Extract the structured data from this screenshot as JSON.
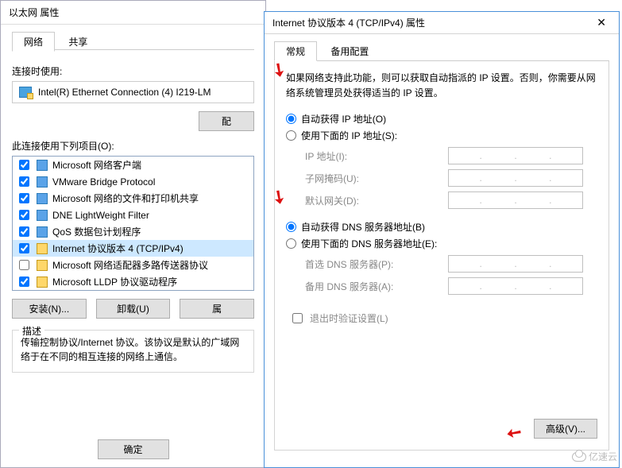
{
  "back": {
    "title": "以太网 属性",
    "tabs": {
      "network": "网络",
      "share": "共享"
    },
    "connect_using": "连接时使用:",
    "adapter": "Intel(R) Ethernet Connection (4) I219-LM",
    "configure_btn": "配",
    "items_label": "此连接使用下列项目(O):",
    "items": [
      {
        "checked": true,
        "icon": "blue",
        "label": "Microsoft 网络客户端"
      },
      {
        "checked": true,
        "icon": "blue",
        "label": "VMware Bridge Protocol"
      },
      {
        "checked": true,
        "icon": "blue",
        "label": "Microsoft 网络的文件和打印机共享"
      },
      {
        "checked": true,
        "icon": "blue",
        "label": "DNE LightWeight Filter"
      },
      {
        "checked": true,
        "icon": "blue",
        "label": "QoS 数据包计划程序"
      },
      {
        "checked": true,
        "icon": "yellow",
        "label": "Internet 协议版本 4 (TCP/IPv4)",
        "selected": true
      },
      {
        "checked": false,
        "icon": "yellow",
        "label": "Microsoft 网络适配器多路传送器协议"
      },
      {
        "checked": true,
        "icon": "yellow",
        "label": "Microsoft LLDP 协议驱动程序"
      }
    ],
    "install_btn": "安装(N)...",
    "uninstall_btn": "卸载(U)",
    "props_btn": "属",
    "desc_legend": "描述",
    "desc_text": "传输控制协议/Internet 协议。该协议是默认的广域网络于在不同的相互连接的网络上通信。",
    "ok_btn": "确定"
  },
  "front": {
    "title": "Internet 协议版本 4 (TCP/IPv4) 属性",
    "tabs": {
      "general": "常规",
      "alt": "备用配置"
    },
    "info": "如果网络支持此功能，则可以获取自动指派的 IP 设置。否则，你需要从网络系统管理员处获得适当的 IP 设置。",
    "ip_auto": "自动获得 IP 地址(O)",
    "ip_manual": "使用下面的 IP 地址(S):",
    "ip_addr": "IP 地址(I):",
    "subnet": "子网掩码(U):",
    "gateway": "默认网关(D):",
    "dns_auto": "自动获得 DNS 服务器地址(B)",
    "dns_manual": "使用下面的 DNS 服务器地址(E):",
    "dns_pref": "首选 DNS 服务器(P):",
    "dns_alt": "备用 DNS 服务器(A):",
    "validate": "退出时验证设置(L)",
    "advanced_btn": "高级(V)..."
  },
  "watermark": "亿速云"
}
